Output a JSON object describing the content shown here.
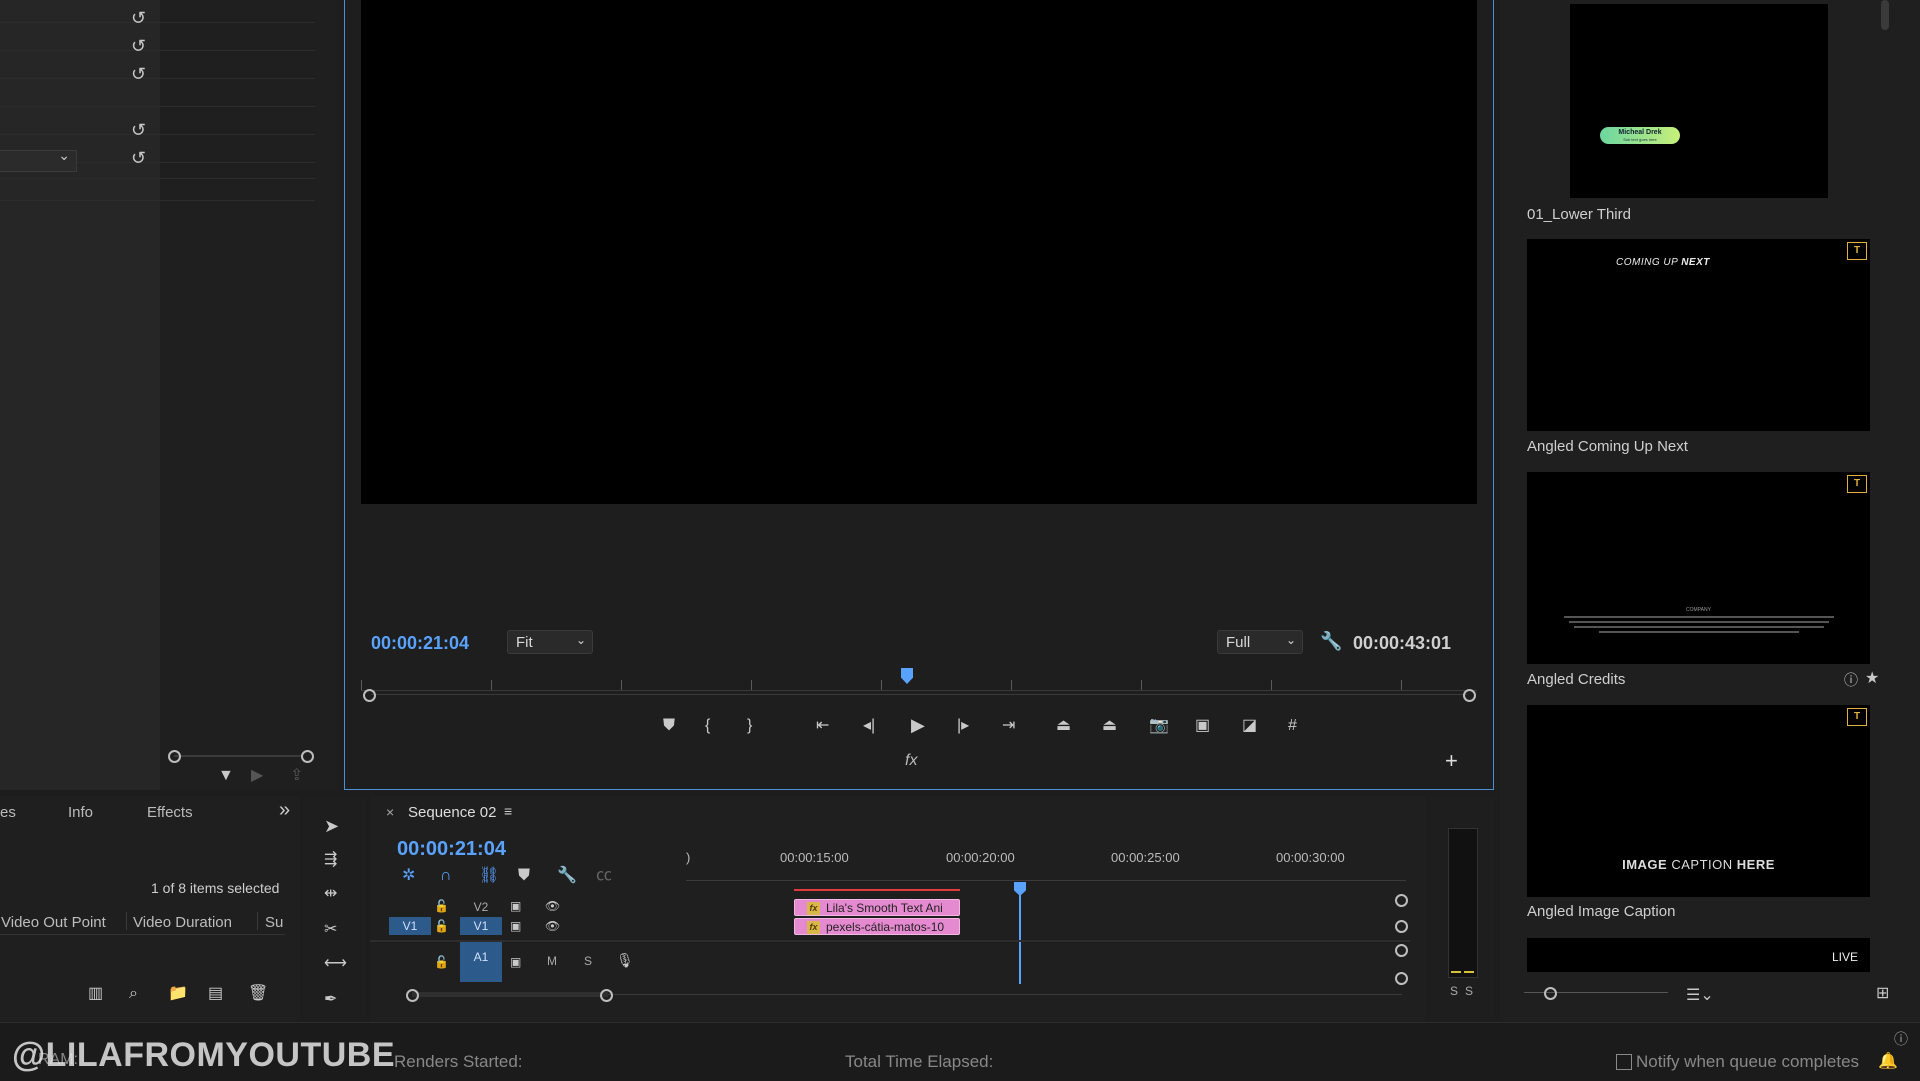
{
  "effect_controls": {
    "dropdown_chevron": "⌄"
  },
  "program_monitor": {
    "timecode_current": "00:00:21:04",
    "zoom": "Fit",
    "resolution": "Full",
    "timecode_duration": "00:00:43:01",
    "fx_label": "fx",
    "add_button": "+"
  },
  "project_panel": {
    "tabs": [
      "es",
      "Info",
      "Effects"
    ],
    "overflow": "»",
    "selection_status": "1 of 8 items selected",
    "columns": [
      "Video Out Point",
      "Video Duration",
      "Su"
    ]
  },
  "timeline": {
    "close": "×",
    "title": "Sequence 02",
    "timecode": "00:00:21:04",
    "ruler_labels": [
      ")",
      "00:00:15:00",
      "00:00:20:00",
      "00:00:25:00",
      "00:00:30:00"
    ],
    "tracks": {
      "v2": "V2",
      "v1_source": "V1",
      "v1": "V1",
      "a1": "A1",
      "mute": "M",
      "solo": "S"
    },
    "clips": [
      {
        "fx": "fx",
        "name": "Lila's Smooth Text Ani"
      },
      {
        "fx": "fx",
        "name": "pexels-cátia-matos-10"
      }
    ]
  },
  "audio_meter": {
    "labels": [
      "S",
      "S"
    ]
  },
  "essential_graphics": {
    "templates": [
      {
        "name": "01_Lower Third",
        "preview_text": "Micheal Drek",
        "preview_sub": "Sub text goes here"
      },
      {
        "name": "Angled Coming Up Next",
        "preview_text_a": "COMING UP",
        "preview_text_b": "NEXT"
      },
      {
        "name": "Angled Credits",
        "preview_text": "COMPANY"
      },
      {
        "name": "Angled Image Caption",
        "preview_text_a": "IMAGE",
        "preview_text_b": "CAPTION",
        "preview_text_c": "HERE"
      }
    ],
    "partial_label": "LIVE",
    "ta_icon": "T"
  },
  "status_bar": {
    "watermark": "@LILAFROMYOUTUBE",
    "ram": "RAM:",
    "renders_started": "Renders Started:",
    "total_time_elapsed": "Total Time Elapsed:",
    "notify": "Notify when queue completes"
  },
  "colors": {
    "accent_blue": "#5aa2ff",
    "clip_pink": "#e58ad0",
    "template_badge": "#e0b23b",
    "in_out_red": "#e03a3a"
  }
}
